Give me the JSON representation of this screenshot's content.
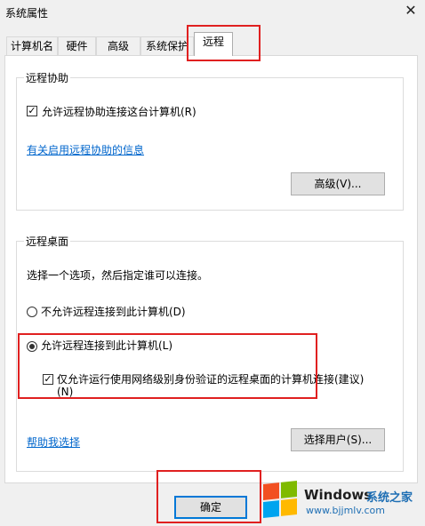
{
  "window": {
    "title": "系统属性"
  },
  "tabs": [
    {
      "label": "计算机名"
    },
    {
      "label": "硬件"
    },
    {
      "label": "高级"
    },
    {
      "label": "系统保护"
    },
    {
      "label": "远程"
    }
  ],
  "remote_assistance": {
    "group_label": "远程协助",
    "allow_checkbox_label": "允许远程协助连接这台计算机(R)",
    "allow_checked": true,
    "info_link": "有关启用远程协助的信息",
    "advanced_button": "高级(V)..."
  },
  "remote_desktop": {
    "group_label": "远程桌面",
    "instruction": "选择一个选项，然后指定谁可以连接。",
    "option_deny": "不允许远程连接到此计算机(D)",
    "option_allow": "允许远程连接到此计算机(L)",
    "selected_option": "allow",
    "nla_checkbox_line1": "仅允许运行使用网络级别身份验证的远程桌面的计算机连接(建议)",
    "nla_checkbox_line2": "(N)",
    "nla_checked": true,
    "help_link": "帮助我选择",
    "select_users_button": "选择用户(S)..."
  },
  "footer": {
    "ok_button": "确定"
  },
  "watermark": {
    "brand": "Windows",
    "cn_text": "系统之家",
    "url": "www.bjjmlv.com",
    "colors": {
      "red": "#f25022",
      "green": "#7fba00",
      "blue": "#00a4ef",
      "yellow": "#ffb900"
    }
  },
  "highlight_color": "#e02020"
}
